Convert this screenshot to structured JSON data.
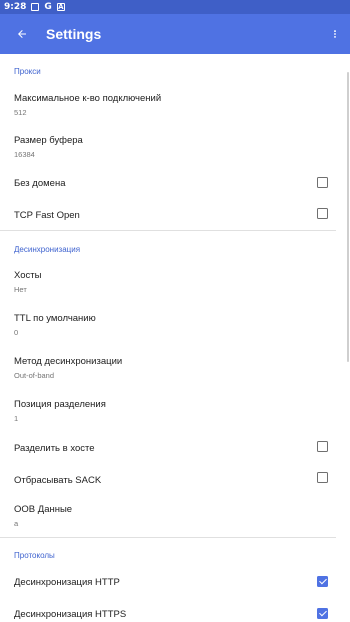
{
  "status_bar": {
    "time": "9:28",
    "icons": [
      "image-icon",
      "google-icon",
      "notification-a-icon"
    ]
  },
  "app_bar": {
    "title": "Settings",
    "back_icon": "arrow-back-icon",
    "more_icon": "more-vert-icon"
  },
  "sections": {
    "proxy": {
      "header": "Прокси",
      "max_connections": {
        "label": "Максимальное к-во подключений",
        "value": "512"
      },
      "buffer_size": {
        "label": "Размер буфера",
        "value": "16384"
      },
      "no_domain": {
        "label": "Без домена",
        "checked": false
      },
      "tcp_fast_open": {
        "label": "TCP Fast Open",
        "checked": false
      }
    },
    "desync": {
      "header": "Десинхронизация",
      "hosts": {
        "label": "Хосты",
        "value": "Нет"
      },
      "default_ttl": {
        "label": "TTL по умолчанию",
        "value": "0"
      },
      "desync_method": {
        "label": "Метод десинхронизации",
        "value": "Out-of-band"
      },
      "split_position": {
        "label": "Позиция разделения",
        "value": "1"
      },
      "split_at_host": {
        "label": "Разделить в хосте",
        "checked": false
      },
      "drop_sack": {
        "label": "Отбрасывать SACK",
        "checked": false
      },
      "oob_data": {
        "label": "OOB Данные",
        "value": "a"
      }
    },
    "protocols": {
      "header": "Протоколы",
      "desync_http": {
        "label": "Десинхронизация HTTP",
        "checked": true
      },
      "desync_https": {
        "label": "Десинхронизация HTTPS",
        "checked": true
      }
    }
  },
  "colors": {
    "app_bar": "#4f72e3",
    "status_bar": "#3f5fc7",
    "accent": "#3f63cf"
  }
}
